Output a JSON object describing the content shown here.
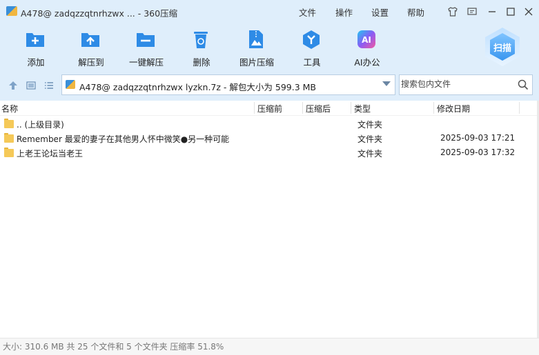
{
  "window": {
    "title": "A478@ zadqzzqtnrhzwx ... - 360压缩",
    "menu": [
      "文件",
      "操作",
      "设置",
      "帮助"
    ]
  },
  "toolbar": {
    "buttons": [
      {
        "label": "添加",
        "icon": "add-icon"
      },
      {
        "label": "解压到",
        "icon": "extract-to-icon"
      },
      {
        "label": "一键解压",
        "icon": "one-click-extract-icon"
      },
      {
        "label": "删除",
        "icon": "delete-icon"
      },
      {
        "label": "图片压缩",
        "icon": "image-compress-icon"
      },
      {
        "label": "工具",
        "icon": "tools-icon"
      },
      {
        "label": "AI办公",
        "icon": "ai-office-icon"
      }
    ],
    "scan_label": "扫描",
    "ai_icon_text": "AI"
  },
  "address": {
    "path": "A478@ zadqzzqtnrhzwx lyzkn.7z - 解包大小为 599.3 MB",
    "search_placeholder": "搜索包内文件"
  },
  "columns": {
    "name": "名称",
    "compressed_before": "压缩前",
    "compressed_after": "压缩后",
    "type": "类型",
    "modified": "修改日期"
  },
  "files": [
    {
      "name": ".. (上级目录)",
      "type": "文件夹",
      "modified": ""
    },
    {
      "name": "Remember 最爱的妻子在其他男人怀中微笑●另一种可能",
      "type": "文件夹",
      "modified": "2025-09-03 17:21"
    },
    {
      "name": "上老王论坛当老王",
      "type": "文件夹",
      "modified": "2025-09-03 17:32"
    }
  ],
  "status": {
    "text": "大小: 310.6 MB 共 25 个文件和 5 个文件夹 压缩率 51.8%"
  },
  "colors": {
    "chrome_bg": "#dfeefb",
    "accent_blue": "#2e8be6",
    "folder_yellow": "#f5c958"
  }
}
